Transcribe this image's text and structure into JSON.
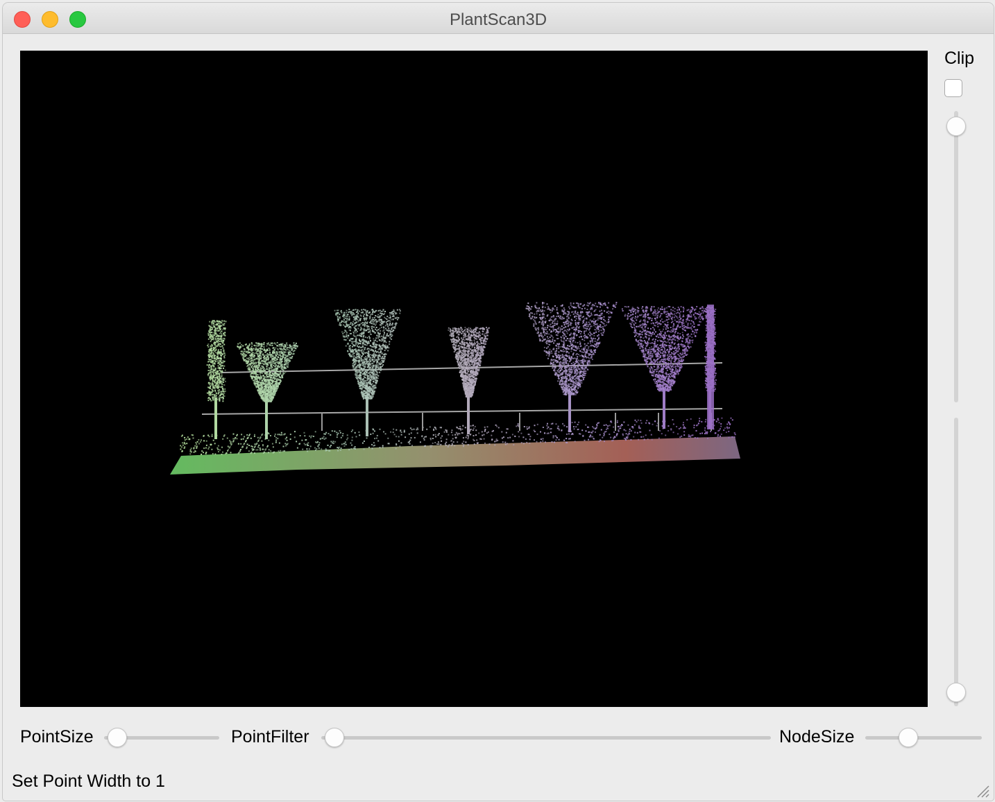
{
  "window": {
    "title": "PlantScan3D",
    "controls": [
      "close-button",
      "minimize-button",
      "zoom-button"
    ]
  },
  "viewport": {
    "content": "point-cloud-render",
    "background": "#000000",
    "palette": {
      "left": "#6fcf6a",
      "mid": "#b4a8a0",
      "right": "#9a6fc4",
      "ground_right": "#c8635c"
    }
  },
  "clip": {
    "label": "Clip",
    "checked": false,
    "upper_slider_value": 1.0,
    "lower_slider_value": 0.0
  },
  "controls": {
    "point_size": {
      "label": "PointSize",
      "value": 0.1
    },
    "point_filter": {
      "label": "PointFilter",
      "value": 0.0
    },
    "node_size": {
      "label": "NodeSize",
      "value": 0.37
    }
  },
  "status": {
    "text": "Set Point Width to 1"
  }
}
